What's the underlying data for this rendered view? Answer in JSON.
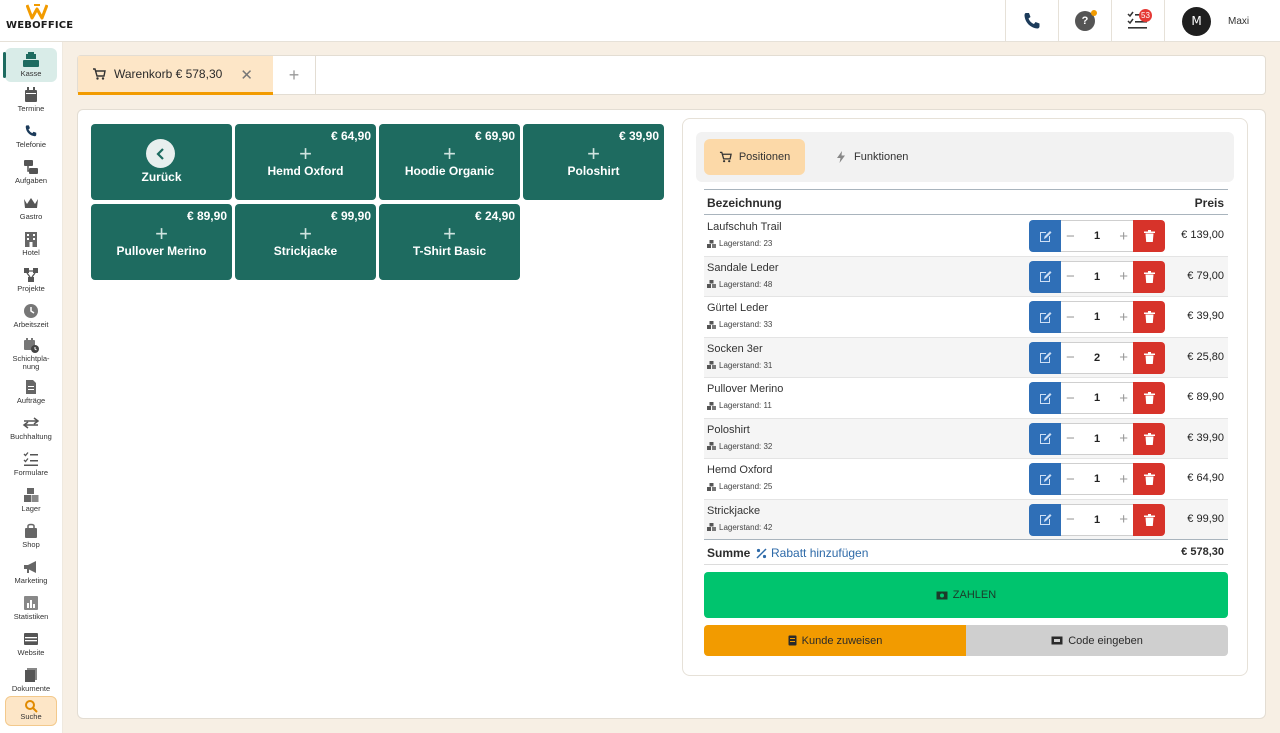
{
  "app": {
    "logo_text": "WEBOFFICE",
    "user_initial": "M",
    "user_name": "Maxi",
    "tasks_badge": "53"
  },
  "colors": {
    "primary": "#1e6b60",
    "accent": "#f29b00",
    "pay": "#00c46e",
    "delete": "#d7332a",
    "edit": "#2f6fb7",
    "active_tab": "#fde6c7"
  },
  "sidebar": {
    "items": [
      {
        "label": "Kasse",
        "icon": "cash-register-icon"
      },
      {
        "label": "Termine",
        "icon": "calendar-icon"
      },
      {
        "label": "Telefonie",
        "icon": "phone-icon"
      },
      {
        "label": "Aufgaben",
        "icon": "tasks-icon"
      },
      {
        "label": "Gastro",
        "icon": "crown-icon"
      },
      {
        "label": "Hotel",
        "icon": "hotel-icon"
      },
      {
        "label": "Projekte",
        "icon": "projects-icon"
      },
      {
        "label": "Arbeitszeit",
        "icon": "clock-icon"
      },
      {
        "label": "Schichtpla-",
        "label2": "nung",
        "icon": "shift-calendar-icon"
      },
      {
        "label": "Aufträge",
        "icon": "document-icon"
      },
      {
        "label": "Buchhaltung",
        "icon": "arrows-icon"
      },
      {
        "label": "Formulare",
        "icon": "list-icon"
      },
      {
        "label": "Lager",
        "icon": "boxes-icon"
      },
      {
        "label": "Shop",
        "icon": "bag-icon"
      },
      {
        "label": "Marketing",
        "icon": "megaphone-icon"
      },
      {
        "label": "Statistiken",
        "icon": "chart-icon"
      },
      {
        "label": "Website",
        "icon": "browser-icon"
      },
      {
        "label": "Dokumente",
        "icon": "files-icon"
      },
      {
        "label": "Suche",
        "icon": "search-icon"
      }
    ]
  },
  "tabs": {
    "active_label": "Warenkorb € 578,30",
    "close": "✕",
    "add": "+"
  },
  "tiles": {
    "back_label": "Zurück",
    "plus": "+",
    "products": [
      {
        "name": "Hemd Oxford",
        "price": "€ 64,90"
      },
      {
        "name": "Hoodie Organic",
        "price": "€ 69,90"
      },
      {
        "name": "Poloshirt",
        "price": "€ 39,90"
      },
      {
        "name": "Pullover Merino",
        "price": "€ 89,90"
      },
      {
        "name": "Strickjacke",
        "price": "€ 99,90"
      },
      {
        "name": "T-Shirt Basic",
        "price": "€ 24,90"
      }
    ]
  },
  "cart": {
    "tab_positions": "Positionen",
    "tab_functions": "Funktionen",
    "col_name": "Bezeichnung",
    "col_price": "Preis",
    "stock_prefix": "Lagerstand:",
    "items": [
      {
        "name": "Laufschuh Trail",
        "stock": "Lagerstand: 23",
        "qty": "1",
        "price": "€ 139,00"
      },
      {
        "name": "Sandale Leder",
        "stock": "Lagerstand: 48",
        "qty": "1",
        "price": "€ 79,00"
      },
      {
        "name": "Gürtel Leder",
        "stock": "Lagerstand: 33",
        "qty": "1",
        "price": "€ 39,90"
      },
      {
        "name": "Socken 3er",
        "stock": "Lagerstand: 31",
        "qty": "2",
        "price": "€ 25,80"
      },
      {
        "name": "Pullover Merino",
        "stock": "Lagerstand: 11",
        "qty": "1",
        "price": "€ 89,90"
      },
      {
        "name": "Poloshirt",
        "stock": "Lagerstand: 32",
        "qty": "1",
        "price": "€ 39,90"
      },
      {
        "name": "Hemd Oxford",
        "stock": "Lagerstand: 25",
        "qty": "1",
        "price": "€ 64,90"
      },
      {
        "name": "Strickjacke",
        "stock": "Lagerstand: 42",
        "qty": "1",
        "price": "€ 99,90"
      }
    ],
    "sum_label": "Summe",
    "discount_label": "Rabatt hinzufügen",
    "total": "€ 578,30",
    "pay_label": "ZAHLEN",
    "customer_label": "Kunde zuweisen",
    "code_label": "Code eingeben"
  }
}
